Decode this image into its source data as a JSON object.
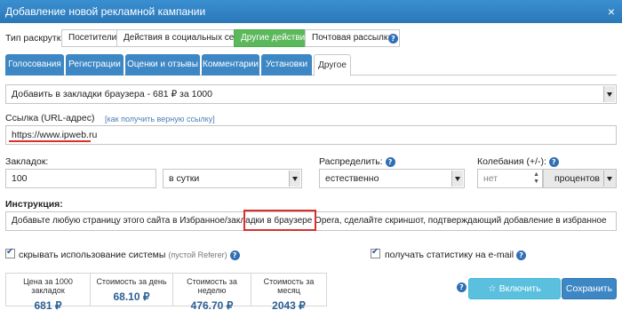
{
  "window": {
    "title": "Добавление новой рекламной кампании",
    "close_glyph": "×"
  },
  "promo_type": {
    "label": "Тип раскрутки:",
    "options": [
      "Посетители",
      "Действия в социальных сетях",
      "Другие действия",
      "Почтовая рассылка"
    ],
    "selected": "Другие действия"
  },
  "tabs": [
    "Голосования",
    "Регистрации",
    "Оценки и отзывы",
    "Комментарии",
    "Установки",
    "Другое"
  ],
  "active_tab": "Другое",
  "action_select": {
    "value": "Добавить в закладки браузера - 681 ₽ за 1000"
  },
  "url": {
    "label": "Ссылка (URL-адрес)",
    "help_link": "как получить верную ссылку",
    "value": "https://www.ipweb.ru"
  },
  "bookmarks": {
    "label": "Закладок:",
    "value": "100",
    "period": "в сутки"
  },
  "distribute": {
    "label": "Распределить:",
    "value": "естественно"
  },
  "fluctuation": {
    "label": "Колебания (+/-):",
    "value_placeholder": "нет",
    "unit": "процентов"
  },
  "instruction": {
    "label": "Инструкция:",
    "text_before": "Добавьте любую страницу этого сайта в Избранное/закладки ",
    "text_highlight": "в браузере Opera,",
    "text_after": " сделайте скриншот, подтверждающий добавление в избранное"
  },
  "options": {
    "hide_system_label": "скрывать использование системы",
    "hide_system_note": "(пустой Referer)",
    "email_stats_label": "получать статистику на e-mail"
  },
  "stats": [
    {
      "header": "Цена за 1000 закладок",
      "value": "681 ₽"
    },
    {
      "header": "Стоимость за день",
      "value": "68.10 ₽"
    },
    {
      "header": "Стоимость за неделю",
      "value": "476.70 ₽"
    },
    {
      "header": "Стоимость за месяц",
      "value": "2043 ₽"
    }
  ],
  "buttons": {
    "premium": "Включить Premium",
    "save": "Сохранить"
  },
  "colors": {
    "accent": "#3d87c4",
    "success": "#5cb85c",
    "highlight": "#d9302c"
  }
}
